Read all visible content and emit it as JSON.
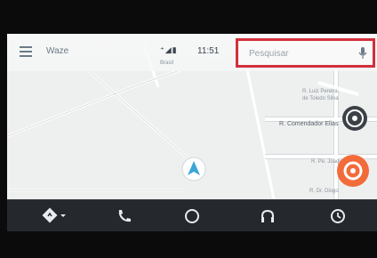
{
  "app": {
    "name": "Waze"
  },
  "status": {
    "time": "11:51",
    "signal_icons": "⁺◢▮",
    "sub_label": "Brasil"
  },
  "search": {
    "placeholder": "Pesquisar"
  },
  "map": {
    "labels": [
      "R. Luiz Pereira",
      "de Toledo Silva",
      "R. Comendador Elias",
      "R. Pe. Joaquim",
      "R. Dr. Diogo"
    ],
    "colors": {
      "arrow": "#3ba5d8",
      "report": "#f26b3a",
      "highlight": "#d32f3a"
    }
  },
  "bottom_nav": [
    {
      "name": "navigation",
      "icon": "directions-icon"
    },
    {
      "name": "phone",
      "icon": "phone-icon"
    },
    {
      "name": "home",
      "icon": "home-circle-icon"
    },
    {
      "name": "audio",
      "icon": "headphones-icon"
    },
    {
      "name": "exit",
      "icon": "exit-icon"
    }
  ]
}
